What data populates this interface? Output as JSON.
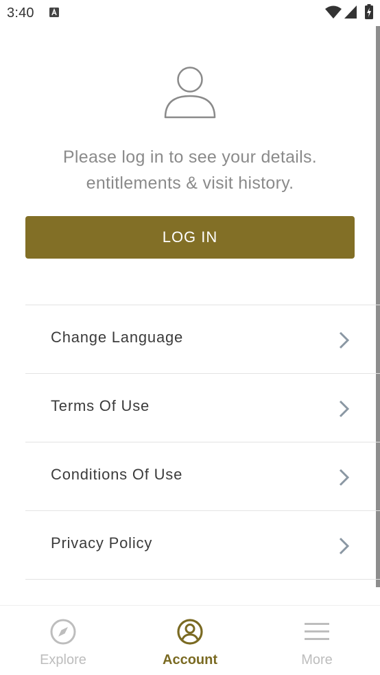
{
  "status_bar": {
    "time": "3:40",
    "icons": [
      "a-notification-icon",
      "wifi-icon",
      "signal-icon",
      "battery-icon"
    ]
  },
  "account": {
    "avatar_icon": "person-icon",
    "prompt": "Please log in to see your details. entitlements & visit history.",
    "login_label": "LOG IN"
  },
  "menu": {
    "items": [
      {
        "label": "Change Language",
        "icon": "chevron-right-icon"
      },
      {
        "label": "Terms Of Use",
        "icon": "chevron-right-icon"
      },
      {
        "label": "Conditions Of Use",
        "icon": "chevron-right-icon"
      },
      {
        "label": "Privacy Policy",
        "icon": "chevron-right-icon"
      }
    ]
  },
  "bottom_nav": {
    "items": [
      {
        "label": "Explore",
        "icon": "compass-icon",
        "active": false
      },
      {
        "label": "Account",
        "icon": "account-circle-icon",
        "active": true
      },
      {
        "label": "More",
        "icon": "hamburger-menu-icon",
        "active": false
      }
    ]
  },
  "colors": {
    "accent": "#826f26",
    "active_nav": "#7a6a22",
    "inactive_nav": "#bdbdbd",
    "prompt_text": "#8a8a8a",
    "menu_text": "#3b3b3b"
  }
}
